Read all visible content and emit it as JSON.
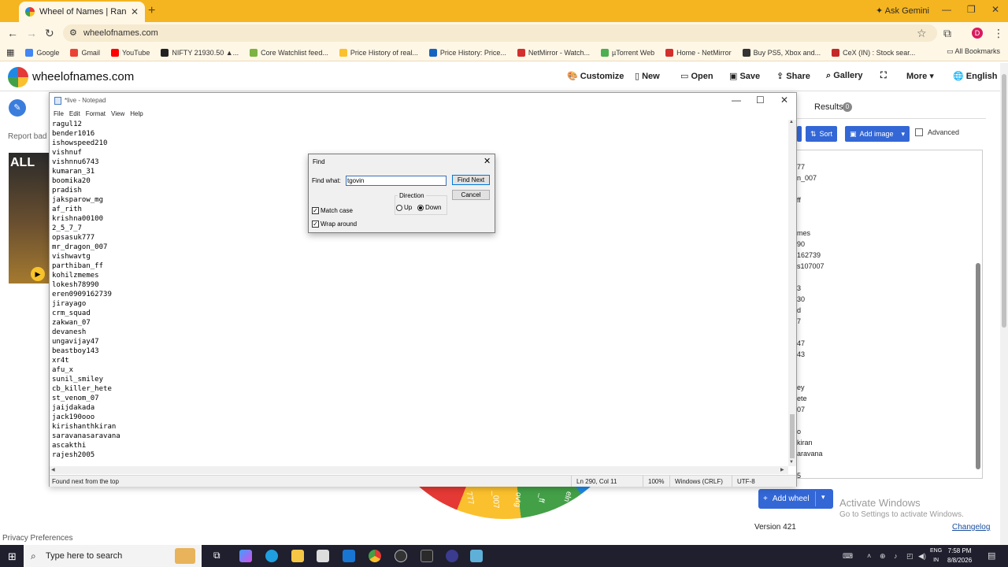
{
  "browser": {
    "tab_title": "Wheel of Names | Random nam",
    "tab_close": "✕",
    "new_tab": "+",
    "ask_gemini": "Ask Gemini",
    "url": "wheelofnames.com",
    "profile_initial": "D",
    "bookmarks": [
      {
        "label": "Google",
        "color": "#4285f4"
      },
      {
        "label": "Gmail",
        "color": "#ea4335"
      },
      {
        "label": "YouTube",
        "color": "#ff0000"
      },
      {
        "label": "NIFTY 21930.50 ▲...",
        "color": "#222222"
      },
      {
        "label": "Core Watchlist feed...",
        "color": "#7cb342"
      },
      {
        "label": "Price History of real...",
        "color": "#fbc02d"
      },
      {
        "label": "Price History: Price...",
        "color": "#1565c0"
      },
      {
        "label": "NetMirror - Watch...",
        "color": "#d32f2f"
      },
      {
        "label": "µTorrent Web",
        "color": "#4caf50"
      },
      {
        "label": "Home - NetMirror",
        "color": "#d32f2f"
      },
      {
        "label": "Buy PS5, Xbox and...",
        "color": "#333333"
      },
      {
        "label": "CeX (IN) : Stock sear...",
        "color": "#c62828"
      }
    ],
    "all_bookmarks": "All Bookmarks"
  },
  "site": {
    "logo_text": "wheelofnames.com",
    "menu": [
      "Customize",
      "New",
      "Open",
      "Save",
      "Share",
      "Gallery",
      "",
      "More",
      "English"
    ],
    "report_text": "Report bad",
    "ad_text": "ALL",
    "privacy": "Privacy Preferences",
    "results_tab": "Results",
    "results_count": "0",
    "sort_label": "Sort",
    "add_image_label": "Add image",
    "advanced_label": "Advanced",
    "entries_partial": [
      "77",
      "n_007",
      "",
      "ff",
      "",
      "",
      "mes",
      "90",
      "162739",
      "s107007",
      "",
      "3",
      "30",
      "d",
      "7",
      "",
      "47",
      "43",
      "",
      "",
      "ey",
      "ete",
      "07",
      "",
      "o",
      "kiran",
      "aravana",
      "",
      "5"
    ],
    "add_wheel": "Add wheel",
    "activate_title": "Activate Windows",
    "activate_sub": "Go to Settings to activate Windows.",
    "version": "Version 421",
    "changelog": "Changelog",
    "wheel_labels": [
      "1",
      "777",
      "_007",
      "ovtg",
      "_ff",
      "eln"
    ]
  },
  "notepad": {
    "title": "*live - Notepad",
    "menu": [
      "File",
      "Edit",
      "Format",
      "View",
      "Help"
    ],
    "lines": [
      "ragul12",
      "bender1016",
      "ishowspeed210",
      "vishnuf",
      "vishnnu6743",
      "kumaran_31",
      "boomika20",
      "pradish",
      "jaksparow_mg",
      "af_rith",
      "krishna00100",
      "2_5_7_7",
      "opsasuk777",
      "mr_dragon_007",
      "vishwavtg",
      "parthiban_ff",
      "kohilzmemes",
      "lokesh78990",
      "eren0909162739",
      "jirayago",
      "crm_squad",
      "zakwan_07",
      "devanesh",
      "ungavijay47",
      "beastboy143",
      "xr4t",
      "afu_x",
      "sunil_smiley",
      "cb_killer_hete",
      "st_venom_07",
      "jaijdakada",
      "jack190ooo",
      "kirishanthkiran",
      "saravanasaravana",
      "ascakthi",
      "rajesh2005"
    ],
    "status_left": "Found next from the top",
    "status_pos": "Ln 290, Col 11",
    "status_zoom": "100%",
    "status_eol": "Windows (CRLF)",
    "status_enc": "UTF-8"
  },
  "find": {
    "title": "Find",
    "find_what_label": "Find what:",
    "find_what_value": "tgovin",
    "find_next": "Find Next",
    "cancel": "Cancel",
    "direction": "Direction",
    "up": "Up",
    "down": "Down",
    "match_case": "Match case",
    "wrap_around": "Wrap around",
    "match_case_checked": true,
    "wrap_around_checked": true,
    "direction_selected": "Down"
  },
  "taskbar": {
    "search_placeholder": "Type here to search",
    "lang_top": "ENG",
    "lang_bottom": "IN",
    "time": "7:58 PM",
    "date": "8/8/2026"
  }
}
